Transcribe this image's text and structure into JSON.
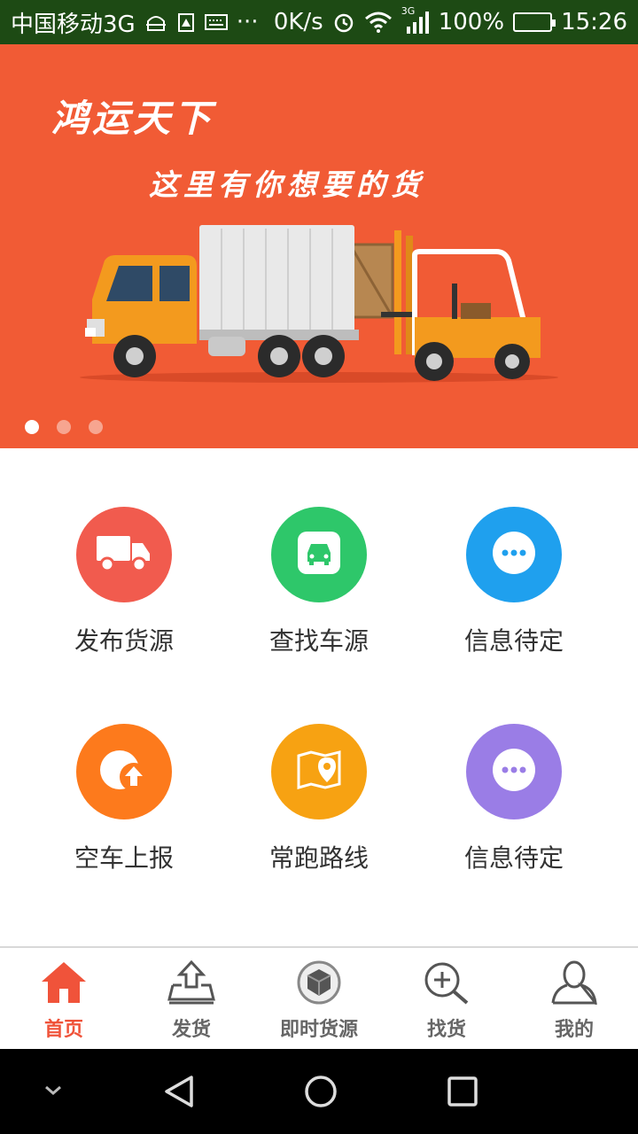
{
  "status_bar": {
    "carrier": "中国移动3G",
    "more": "···",
    "speed": "0K/s",
    "network": "3G",
    "battery": "100%",
    "time": "15:26"
  },
  "banner": {
    "title": "鸿运天下",
    "subtitle": "这里有你想要的货",
    "page_count": 3,
    "active_page": 1
  },
  "grid": {
    "items": [
      {
        "label": "发布货源",
        "color": "#f15b4e",
        "icon": "truck-icon"
      },
      {
        "label": "查找车源",
        "color": "#2ec76a",
        "icon": "car-icon"
      },
      {
        "label": "信息待定",
        "color": "#1fa0ee",
        "icon": "more-icon"
      },
      {
        "label": "空车上报",
        "color": "#fd7a1c",
        "icon": "upload-icon"
      },
      {
        "label": "常跑路线",
        "color": "#f7a212",
        "icon": "map-pin-icon"
      },
      {
        "label": "信息待定",
        "color": "#9a7de6",
        "icon": "more-icon"
      }
    ]
  },
  "bottom_nav": {
    "items": [
      {
        "label": "首页",
        "icon": "home-icon",
        "active": true
      },
      {
        "label": "发货",
        "icon": "ship-tray-icon",
        "active": false
      },
      {
        "label": "即时货源",
        "icon": "box-icon",
        "active": false
      },
      {
        "label": "找货",
        "icon": "search-plus-icon",
        "active": false
      },
      {
        "label": "我的",
        "icon": "user-icon",
        "active": false
      }
    ],
    "active_color": "#f0533a"
  }
}
